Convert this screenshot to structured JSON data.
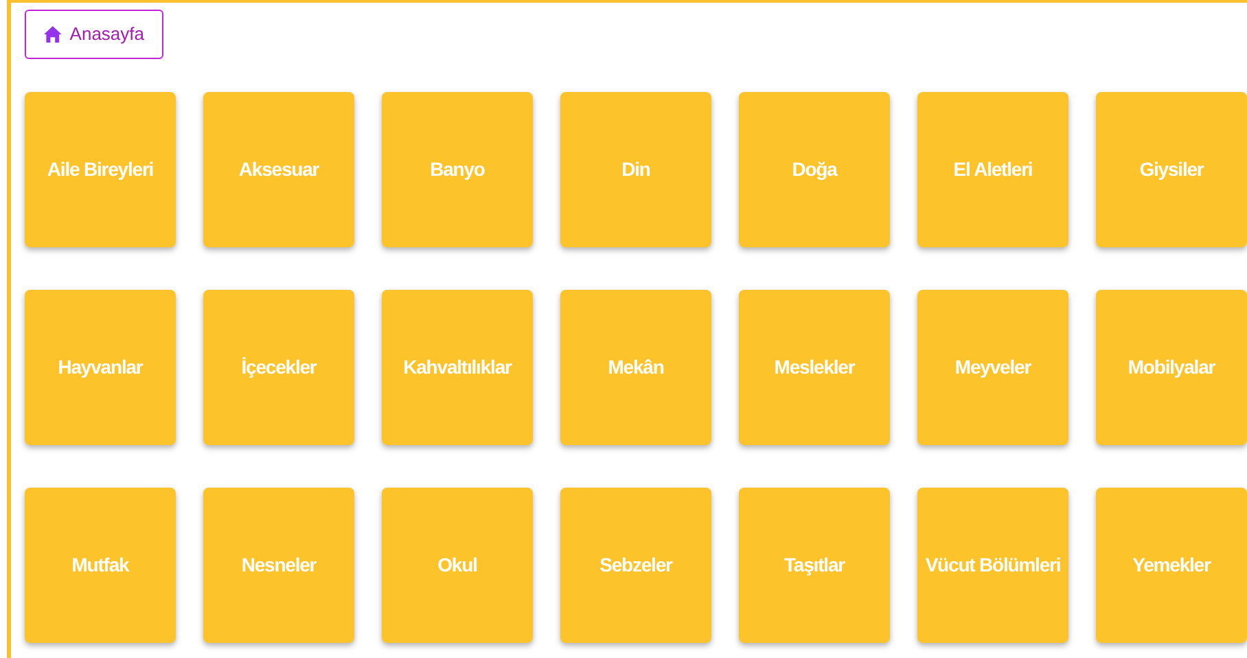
{
  "home_button": {
    "label": "Anasayfa"
  },
  "categories": [
    {
      "label": "Aile Bireyleri"
    },
    {
      "label": "Aksesuar"
    },
    {
      "label": "Banyo"
    },
    {
      "label": "Din"
    },
    {
      "label": "Doğa"
    },
    {
      "label": "El Aletleri"
    },
    {
      "label": "Giysiler"
    },
    {
      "label": "Hayvanlar"
    },
    {
      "label": "İçecekler"
    },
    {
      "label": "Kahvaltılıklar"
    },
    {
      "label": "Mekân"
    },
    {
      "label": "Meslekler"
    },
    {
      "label": "Meyveler"
    },
    {
      "label": "Mobilyalar"
    },
    {
      "label": "Mutfak"
    },
    {
      "label": "Nesneler"
    },
    {
      "label": "Okul"
    },
    {
      "label": "Sebzeler"
    },
    {
      "label": "Taşıtlar"
    },
    {
      "label": "Vücut Bölümleri"
    },
    {
      "label": "Yemekler"
    }
  ]
}
